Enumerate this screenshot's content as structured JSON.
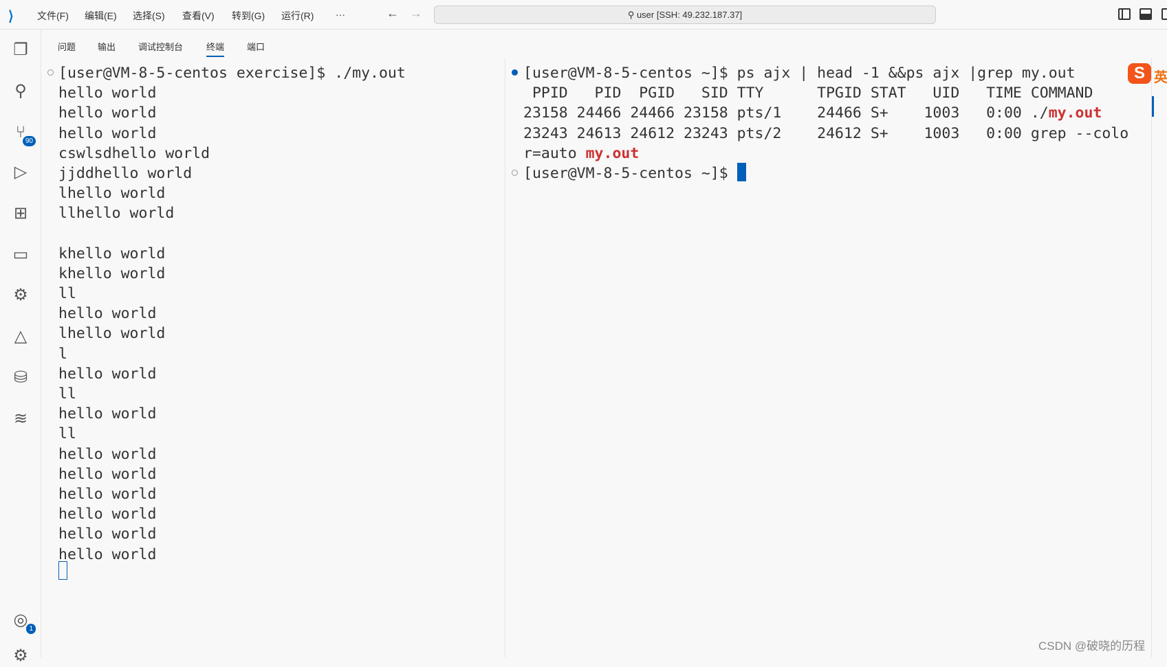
{
  "titlebar": {
    "menus": [
      "文件(F)",
      "编辑(E)",
      "选择(S)",
      "查看(V)",
      "转到(G)",
      "运行(R)",
      "···"
    ],
    "search": "user [SSH: 49.232.187.37]"
  },
  "activity": {
    "source_control_badge": "90",
    "accounts_badge": "1"
  },
  "panel_tabs": [
    "问题",
    "输出",
    "调试控制台",
    "终端",
    "端口"
  ],
  "active_tab": "终端",
  "left_terminal": {
    "lines": [
      "[user@VM-8-5-centos exercise]$ ./my.out",
      "hello world",
      "hello world",
      "hello world",
      "cswlsdhello world",
      "jjddhello world",
      "lhello world",
      "llhello world",
      "",
      "khello world",
      "khello world",
      "ll",
      "hello world",
      "lhello world",
      "l",
      "hello world",
      "ll",
      "hello world",
      "ll",
      "hello world",
      "hello world",
      "hello world",
      "hello world",
      "hello world",
      "hello world"
    ]
  },
  "right_terminal": {
    "line1": "[user@VM-8-5-centos ~]$ ps ajx | head -1 &&ps ajx |grep my.out",
    "header": " PPID   PID  PGID   SID TTY      TPGID STAT   UID   TIME COMMAND",
    "row1_pre": "23158 24466 24466 23158 pts/1    24466 S+    1003   0:00 ./",
    "row1_hl": "my.out",
    "row2": "23243 24613 24612 23243 pts/2    24612 S+    1003   0:00 grep --colo",
    "row3_pre": "r=auto ",
    "row3_hl": "my.out",
    "prompt": "[user@VM-8-5-centos ~]$ "
  },
  "ime_label": "英",
  "watermark": "CSDN @破晓的历程",
  "colors": {
    "accent": "#005fb8",
    "highlight": "#cd3131"
  }
}
